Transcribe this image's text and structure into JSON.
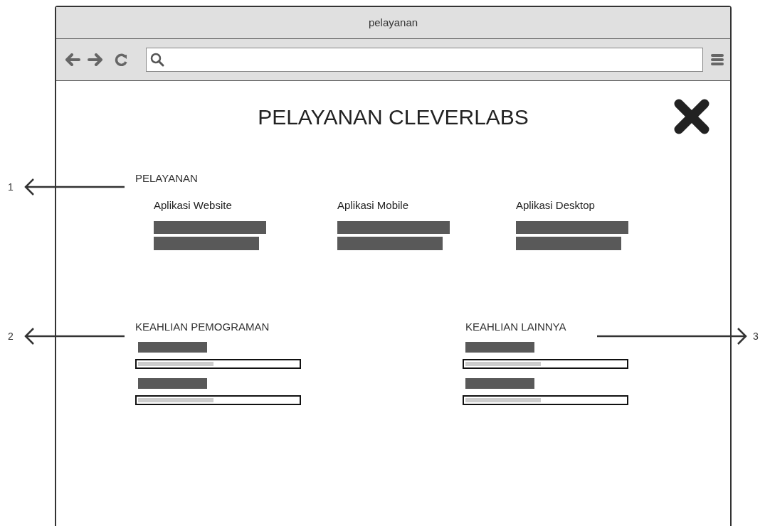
{
  "window": {
    "title": "pelayanan"
  },
  "page": {
    "heading": "PELAYANAN CLEVERLABS"
  },
  "services": {
    "title": "PELAYANAN",
    "items": [
      {
        "title": "Aplikasi Website"
      },
      {
        "title": "Aplikasi Mobile"
      },
      {
        "title": "Aplikasi Desktop"
      }
    ]
  },
  "skill_groups": [
    {
      "title": "KEAHLIAN PEMOGRAMAN",
      "skills": [
        {
          "level": 0.47
        },
        {
          "level": 0.47
        }
      ]
    },
    {
      "title": "KEAHLIAN LAINNYA",
      "skills": [
        {
          "level": 0.47
        },
        {
          "level": 0.47
        }
      ]
    }
  ],
  "annotations": [
    {
      "number": "1",
      "kind": "left"
    },
    {
      "number": "2",
      "kind": "left"
    },
    {
      "number": "3",
      "kind": "right"
    }
  ]
}
